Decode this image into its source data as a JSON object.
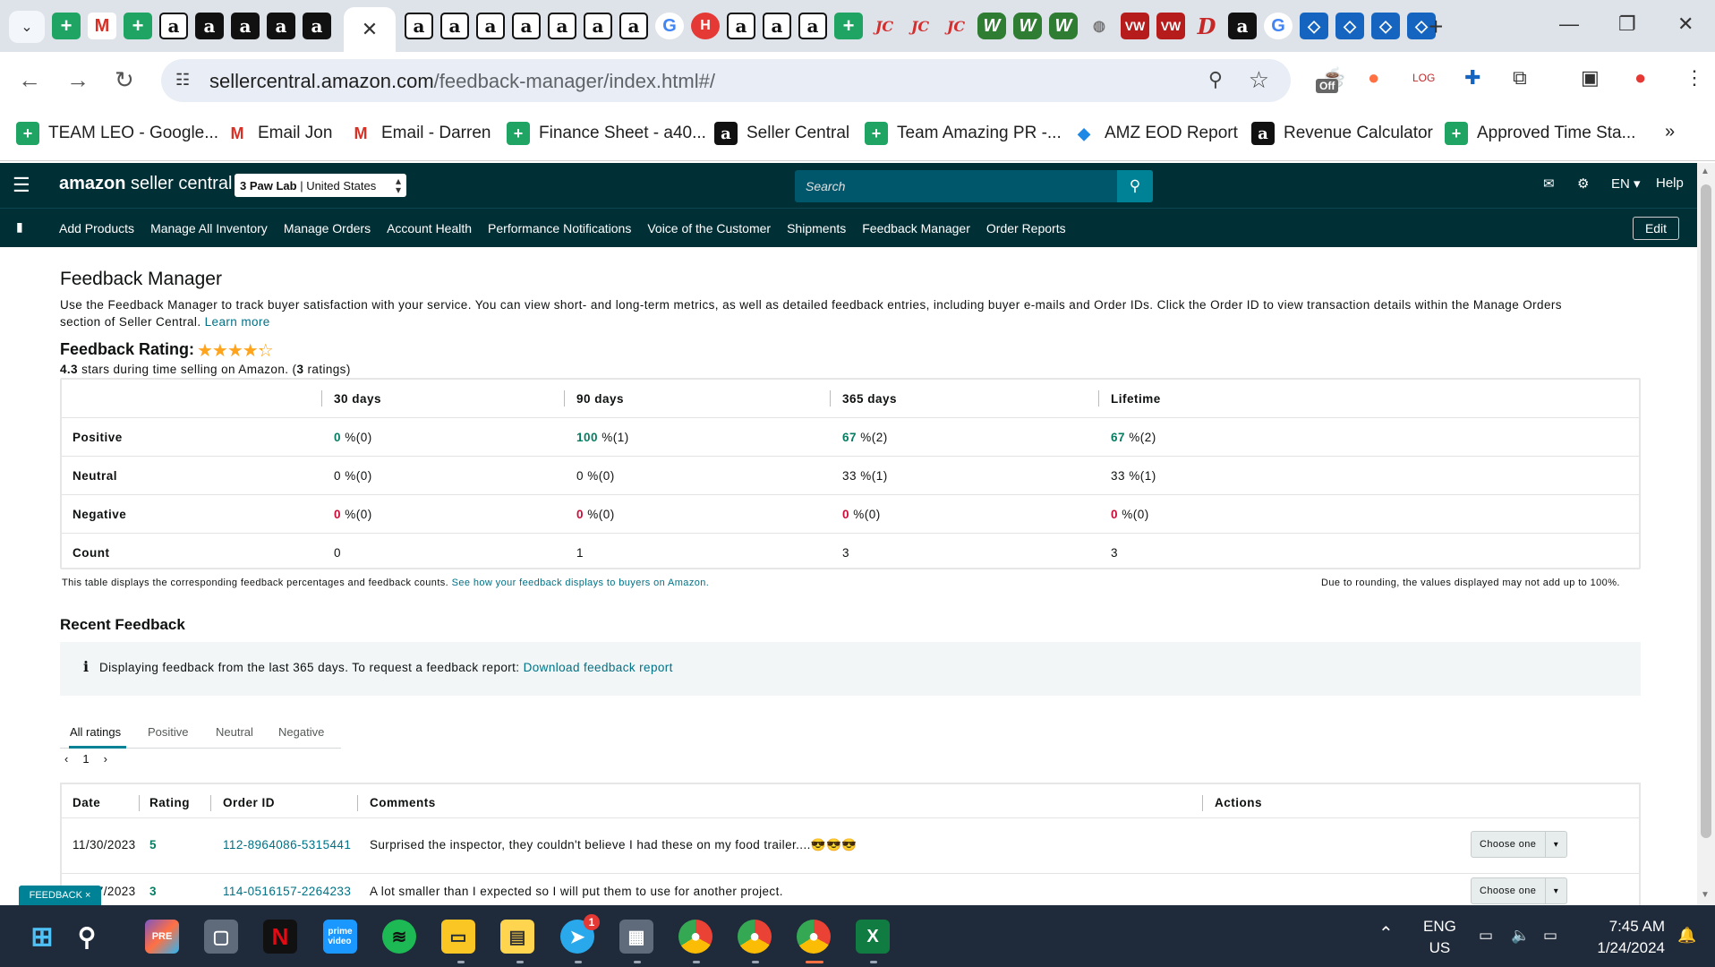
{
  "browser": {
    "url_domain": "sellercentral.amazon.com",
    "url_path": "/feedback-manager/index.html#/",
    "bookmarks": [
      {
        "label": "TEAM LEO - Google...",
        "icon": "sheets-icon"
      },
      {
        "label": "Email Jon",
        "icon": "gmail-icon"
      },
      {
        "label": "Email - Darren",
        "icon": "gmail-icon"
      },
      {
        "label": "Finance Sheet - a40...",
        "icon": "sheets-icon"
      },
      {
        "label": "Seller Central",
        "icon": "amazon-icon"
      },
      {
        "label": "Team Amazing PR -...",
        "icon": "sheets-icon"
      },
      {
        "label": "AMZ EOD Report",
        "icon": "report-icon"
      },
      {
        "label": "Revenue Calculator",
        "icon": "amazon-icon"
      },
      {
        "label": "Approved Time Sta...",
        "icon": "sheets-icon"
      }
    ],
    "ext_off_badge": "Off"
  },
  "header": {
    "logo_amazon": "amazon",
    "logo_rest": " seller central",
    "store_name": "3 Paw Lab",
    "store_region": "United States",
    "search_placeholder": "Search",
    "language": "EN",
    "help": "Help"
  },
  "nav": {
    "links": [
      "Add Products",
      "Manage All Inventory",
      "Manage Orders",
      "Account Health",
      "Performance Notifications",
      "Voice of the Customer",
      "Shipments",
      "Feedback Manager",
      "Order Reports"
    ],
    "edit": "Edit"
  },
  "page": {
    "title": "Feedback Manager",
    "description_line1": "Use the Feedback Manager to track buyer satisfaction with your service. You can view short- and long-term metrics, as well as detailed feedback entries, including buyer e-mails and Order IDs. Click the Order ID to view transaction details within the Manage Orders",
    "description_line2": "section of Seller Central.",
    "learn_more": "Learn more",
    "rating_title": "Feedback Rating:",
    "rating_value": 4.3,
    "rating_stars": "4.3",
    "rating_sub_pre": " stars during time selling on Amazon. (",
    "rating_count": "3",
    "rating_sub_post": " ratings)"
  },
  "metrics": {
    "columns": [
      "30 days",
      "90 days",
      "365 days",
      "Lifetime"
    ],
    "rows": [
      {
        "label": "Positive",
        "cells": [
          {
            "v": "0",
            "r": " %(0)",
            "tone": "green"
          },
          {
            "v": "100",
            "r": " %(1)",
            "tone": "green"
          },
          {
            "v": "67",
            "r": " %(2)",
            "tone": "green"
          },
          {
            "v": "67",
            "r": " %(2)",
            "tone": "green"
          }
        ]
      },
      {
        "label": "Neutral",
        "cells": [
          {
            "v": "0",
            "r": " %(0)",
            "tone": "norm"
          },
          {
            "v": "0",
            "r": " %(0)",
            "tone": "norm"
          },
          {
            "v": "33",
            "r": " %(1)",
            "tone": "norm"
          },
          {
            "v": "33",
            "r": " %(1)",
            "tone": "norm"
          }
        ]
      },
      {
        "label": "Negative",
        "cells": [
          {
            "v": "0",
            "r": " %(0)",
            "tone": "red"
          },
          {
            "v": "0",
            "r": " %(0)",
            "tone": "red"
          },
          {
            "v": "0",
            "r": " %(0)",
            "tone": "red"
          },
          {
            "v": "0",
            "r": " %(0)",
            "tone": "red"
          }
        ]
      },
      {
        "label": "Count",
        "cells": [
          {
            "v": "0",
            "r": "",
            "tone": "norm"
          },
          {
            "v": "1",
            "r": "",
            "tone": "norm"
          },
          {
            "v": "3",
            "r": "",
            "tone": "norm"
          },
          {
            "v": "3",
            "r": "",
            "tone": "norm"
          }
        ]
      }
    ],
    "footnote_left": "This table displays the corresponding feedback percentages and feedback counts.",
    "footnote_link": "See how your feedback displays to buyers on Amazon.",
    "footnote_right": "Due to rounding, the values displayed may not add up to 100%."
  },
  "recent": {
    "title": "Recent Feedback",
    "info_text": "Displaying feedback from the last 365 days. To request a feedback report:",
    "info_link": "Download feedback report",
    "tabs": [
      "All ratings",
      "Positive",
      "Neutral",
      "Negative"
    ],
    "active_tab": "All ratings",
    "page": "1",
    "columns": [
      "Date",
      "Rating",
      "Order ID",
      "Comments",
      "Actions"
    ],
    "rows": [
      {
        "date": "11/30/2023",
        "rating": "5",
        "order_id": "112-8964086-5315441",
        "comment": "Surprised the inspector, they couldn't believe I had these on my food trailer....😎😎😎",
        "action": "Choose one"
      },
      {
        "date": "11/27/2023",
        "rating": "3",
        "order_id": "114-0516157-2264233",
        "comment": "A lot smaller than I expected so I will put them to use for another project.",
        "action": "Choose one"
      }
    ],
    "feedback_tab": "FEEDBACK ×"
  },
  "taskbar": {
    "lang_top": "ENG",
    "lang_bottom": "US",
    "time": "7:45 AM",
    "date": "1/24/2024",
    "telegram_badge": "1"
  },
  "colors": {
    "header_bg": "#002f36",
    "link": "#007185",
    "positive": "#067d62",
    "negative": "#cc0c39",
    "star": "#ffa41c"
  }
}
